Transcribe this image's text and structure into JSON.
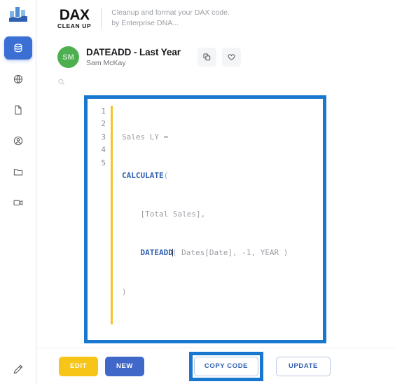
{
  "sidebar": {
    "logo_name": "bar-chart-logo",
    "items": [
      {
        "name": "database",
        "label": "Database",
        "active": true
      },
      {
        "name": "globe",
        "label": "Globe",
        "active": false
      },
      {
        "name": "file",
        "label": "File",
        "active": false
      },
      {
        "name": "user-circle",
        "label": "Account",
        "active": false
      },
      {
        "name": "folder",
        "label": "Folder",
        "active": false
      },
      {
        "name": "video",
        "label": "Video",
        "active": false
      }
    ],
    "bottom_item": {
      "name": "pen",
      "label": "Pen"
    }
  },
  "header": {
    "brand_primary": "DAX",
    "brand_secondary": "CLEAN UP",
    "tagline_line1": "Cleanup and format your DAX code.",
    "tagline_line2": "by Enterprise DNA..."
  },
  "snippet": {
    "avatar_initials": "SM",
    "avatar_color": "#4caf50",
    "title": "DATEADD - Last Year",
    "author": "Sam McKay",
    "actions": [
      {
        "name": "copy-icon",
        "label": "Copy"
      },
      {
        "name": "heart-icon",
        "label": "Favorite"
      }
    ]
  },
  "search": {
    "placeholder": "",
    "value": "",
    "icon": "search-icon"
  },
  "editor": {
    "highlight_color": "#1878d0",
    "gutter_bar_color": "#f8c22c",
    "line_numbers": [
      "1",
      "2",
      "3",
      "4",
      "5"
    ],
    "lines": [
      {
        "segments": [
          {
            "text": "Sales LY =",
            "type": "plain"
          }
        ]
      },
      {
        "segments": [
          {
            "text": "CALCULATE",
            "type": "fn"
          },
          {
            "text": "(",
            "type": "paren"
          }
        ]
      },
      {
        "segments": [
          {
            "text": "    [Total Sales],",
            "type": "plain"
          }
        ]
      },
      {
        "segments": [
          {
            "text": "    ",
            "type": "plain"
          },
          {
            "text": "DATEADD",
            "type": "fn"
          },
          {
            "text": "(",
            "type": "paren"
          },
          {
            "text": " Dates[Date], -1, YEAR )",
            "type": "plain"
          }
        ]
      },
      {
        "segments": [
          {
            "text": ")",
            "type": "plain"
          }
        ]
      }
    ],
    "full_code": "Sales LY =\nCALCULATE(\n    [Total Sales],\n    DATEADD( Dates[Date], -1, YEAR )\n)"
  },
  "footer": {
    "edit_label": "EDIT",
    "new_label": "NEW",
    "copy_label": "COPY CODE",
    "update_label": "UPDATE",
    "copy_highlight_color": "#1878d0"
  }
}
